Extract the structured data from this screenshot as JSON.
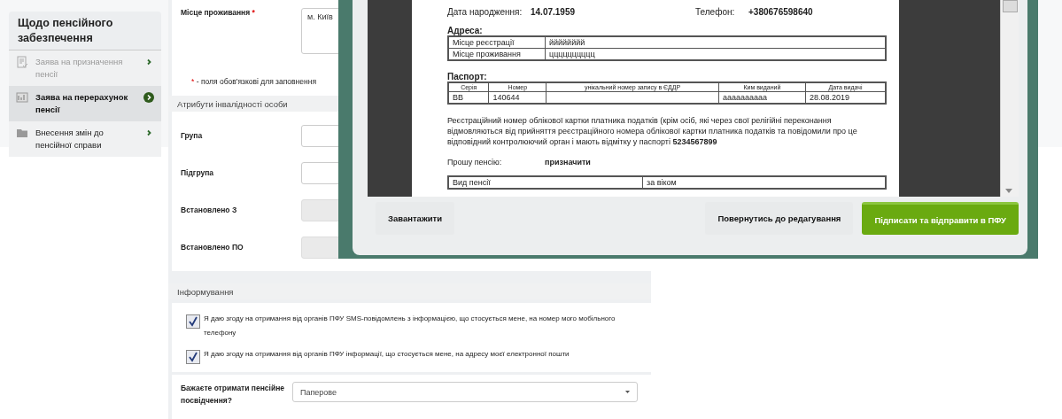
{
  "sidebar": {
    "title": "Щодо пенсійного забезпечення",
    "items": [
      {
        "label": "Заява на призначення пенсії",
        "kind": "document",
        "disabled": true,
        "selected": false
      },
      {
        "label": "Заява на перерахунок пенсії",
        "kind": "chart",
        "disabled": false,
        "selected": true
      },
      {
        "label": "Внесення змін до пенсійної справи",
        "kind": "folder",
        "disabled": false,
        "selected": false
      }
    ]
  },
  "form": {
    "residence": {
      "label": "Місце проживання",
      "required": "*",
      "value": "м. Київ"
    },
    "required_note": {
      "mark": "*",
      "text": "- поля обов'язкові для заповнення"
    },
    "disability": {
      "title": "Атрибути інвалідності особи",
      "fields": [
        {
          "label": "Група",
          "disabled": false
        },
        {
          "label": "Підгрупа",
          "disabled": false
        },
        {
          "label": "Встановлено З",
          "disabled": true
        },
        {
          "label": "Встановлено ПО",
          "disabled": true
        }
      ]
    },
    "informing": {
      "title": "Інформування",
      "consents": [
        {
          "text": "Я даю згоду на отримання від органів ПФУ SMS-повідомлень з інформацією, що стосується мене, на номер мого мобільного телефону",
          "checked": true
        },
        {
          "text": "Я даю згоду на отримання від органів ПФУ інформації, що стосується мене, на адресу моєї електронної пошти",
          "checked": true
        }
      ]
    },
    "certificate": {
      "label": "Бажаєте отримати пенсійне посвідчення?",
      "value": "Паперове"
    }
  },
  "modal": {
    "document": {
      "birth_label": "Дата народження:",
      "birth_value": "14.07.1959",
      "phone_label": "Телефон:",
      "phone_value": "+380676598640",
      "address_title": "Адреса:",
      "address_rows": [
        [
          "Місце реєстрації",
          "йййййййй"
        ],
        [
          "Місце проживання",
          "цццццццццц"
        ]
      ],
      "passport_title": "Паспорт:",
      "passport_columns": [
        "Серія",
        "Номер",
        "унікальний номер запису в ЄДДР",
        "Ким виданий",
        "Дата видачі"
      ],
      "passport_row": {
        "series": "ВВ",
        "number": "140644",
        "issued_by": "аааааааааа",
        "date": "28.08.2019"
      },
      "tax_text": "Реєстраційний номер облікової картки платника податків (крім осіб, які через свої релігійні переконання відмовляються від прийняття реєстраційного номера облікової картки платника податків та повідомили про це відповідний контролюючий орган і мають відмітку у паспорті **5234567899**",
      "request_label": "Прошу пенсію:",
      "request_value": "призначити",
      "pension_row": [
        "Вид пенсії",
        "за віком"
      ]
    },
    "buttons": [
      {
        "label": "Завантажити",
        "kind": "plain"
      },
      {
        "label": "Повернутись до редагування",
        "kind": "plain"
      },
      {
        "label": "Підписати та відправити в ПФУ",
        "kind": "primary"
      }
    ]
  }
}
